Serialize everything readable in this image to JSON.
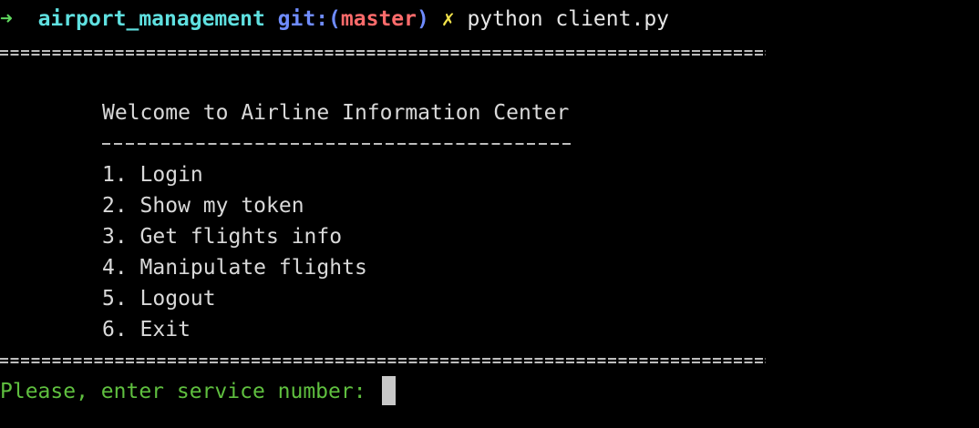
{
  "prompt": {
    "arrow": "➜",
    "directory": "airport_management",
    "git_prefix": "git:(",
    "branch": "master",
    "git_suffix": ")",
    "dirty_mark": "✗",
    "command": "python client.py"
  },
  "menu": {
    "title": "Welcome to Airline Information Center",
    "dash_rule": "-------------------------------------",
    "items": [
      "1. Login",
      "2. Show my token",
      "3. Get flights info",
      "4. Manipulate flights",
      "5. Logout",
      "6. Exit"
    ]
  },
  "input": {
    "prompt_text": "Please, enter service number: "
  },
  "colors": {
    "background": "#000000",
    "arrow": "#5fd75f",
    "directory": "#5fe0e0",
    "git": "#6f8cff",
    "branch": "#ff6b6b",
    "dirty": "#f2e34b",
    "input_prompt": "#5fbf3f"
  }
}
